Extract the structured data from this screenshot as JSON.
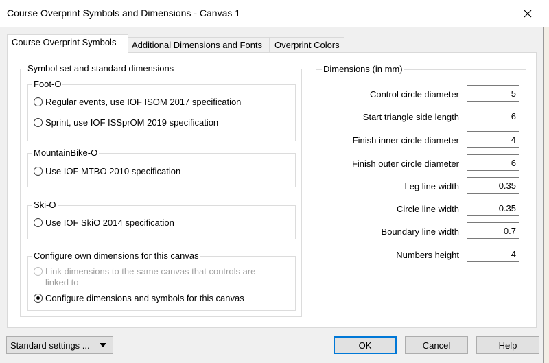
{
  "window": {
    "title": "Course Overprint Symbols and Dimensions - Canvas 1"
  },
  "tabs": [
    "Course Overprint Symbols",
    "Additional Dimensions and Fonts",
    "Overprint Colors"
  ],
  "symbol_set": {
    "legend": "Symbol set and standard dimensions",
    "foot_o": {
      "legend": "Foot-O",
      "options": [
        "Regular events, use IOF ISOM 2017 specification",
        "Sprint, use IOF ISSprOM 2019 specification"
      ]
    },
    "mtb_o": {
      "legend": "MountainBike-O",
      "options": [
        "Use IOF MTBO 2010 specification"
      ]
    },
    "ski_o": {
      "legend": "Ski-O",
      "options": [
        "Use IOF SkiO 2014 specification"
      ]
    },
    "own": {
      "legend": "Configure own dimensions for this canvas",
      "link_line1": "Link dimensions to the same canvas that controls are",
      "link_line2": "linked to",
      "configure": "Configure dimensions and symbols for this canvas"
    }
  },
  "dimensions": {
    "legend": "Dimensions (in mm)",
    "rows": [
      {
        "label": "Control circle diameter",
        "value": "5"
      },
      {
        "label": "Start triangle side length",
        "value": "6"
      },
      {
        "label": "Finish inner circle diameter",
        "value": "4"
      },
      {
        "label": "Finish outer circle diameter",
        "value": "6"
      },
      {
        "label": "Leg line width",
        "value": "0.35"
      },
      {
        "label": "Circle line width",
        "value": "0.35"
      },
      {
        "label": "Boundary line width",
        "value": "0.7"
      },
      {
        "label": "Numbers height",
        "value": "4"
      }
    ]
  },
  "buttons": {
    "standard_settings": "Standard settings ...",
    "ok": "OK",
    "cancel": "Cancel",
    "help": "Help"
  },
  "icons": {
    "close": "close-icon",
    "dropdown": "triangle-down-icon"
  }
}
